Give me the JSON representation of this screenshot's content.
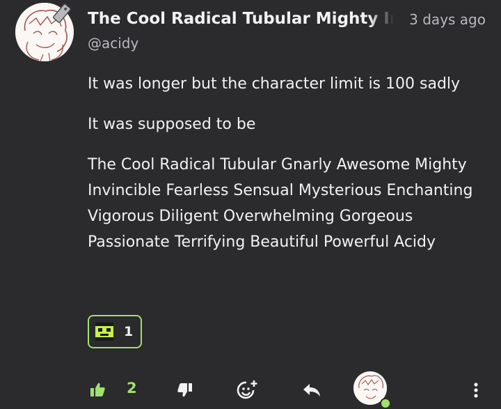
{
  "post": {
    "author_name": "The Cool Radical Tubular Mighty Invincible",
    "handle": "@acidy",
    "timestamp": "3 days ago",
    "paragraphs": [
      "It was longer but the character limit is 100 sadly",
      "It was supposed to be",
      "The Cool Radical Tubular Gnarly Awesome Mighty Invincible Fearless Sensual Mysterious Enchanting Vigorous Diligent Overwhelming Gorgeous Passionate Terrifying Beautiful Powerful Acidy"
    ]
  },
  "reaction": {
    "count": "1",
    "emoji": "green-square-face-emoji"
  },
  "actions": {
    "like_count": "2",
    "icons": [
      "thumbs-up-icon",
      "thumbs-down-icon",
      "add-reaction-icon",
      "reply-icon",
      "more-options-icon"
    ]
  },
  "colors": {
    "background": "#2b2a2d",
    "accent": "#9fe36a",
    "text": "#f2f2f2",
    "muted": "#b9b9bd"
  }
}
